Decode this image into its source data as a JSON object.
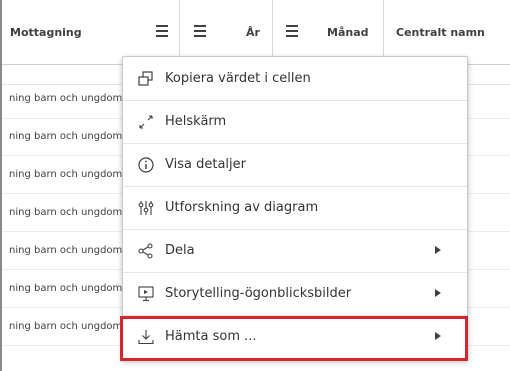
{
  "table": {
    "columns": [
      {
        "label": "Mottagning"
      },
      {
        "label": "År"
      },
      {
        "label": "Månad"
      },
      {
        "label": "Centralt namn"
      }
    ],
    "rows": [
      "ning barn och ungdom",
      "ning barn och ungdom",
      "ning barn och ungdom",
      "ning barn och ungdom",
      "ning barn och ungdom",
      "ning barn och ungdom",
      "ning barn och ungdom"
    ]
  },
  "context_menu": {
    "items": [
      {
        "label": "Kopiera värdet i cellen",
        "icon": "copy-icon"
      },
      {
        "label": "Helskärm",
        "icon": "expand-icon"
      },
      {
        "label": "Visa detaljer",
        "icon": "info-icon"
      },
      {
        "label": "Utforskning av diagram",
        "icon": "sliders-icon"
      },
      {
        "label": "Dela",
        "icon": "share-icon",
        "submenu": true
      },
      {
        "label": "Storytelling-ögonblicksbilder",
        "icon": "snapshot-icon",
        "submenu": true
      },
      {
        "label": "Hämta som ...",
        "icon": "download-icon",
        "submenu": true,
        "highlighted": true
      }
    ]
  },
  "colors": {
    "highlight": "#d9262c",
    "text": "#404040"
  }
}
